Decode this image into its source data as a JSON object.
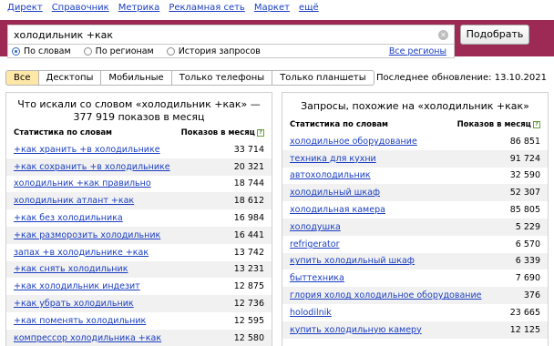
{
  "topnav": [
    "Директ",
    "Справочник",
    "Метрика",
    "Рекламная сеть",
    "Маркет",
    "ещё"
  ],
  "search": {
    "value": "холодильник +как",
    "button": "Подобрать"
  },
  "options": {
    "by_words": "По словам",
    "by_regions": "По регионам",
    "history": "История запросов",
    "all_regions": "Все регионы",
    "selected": "По словам"
  },
  "device_tabs": [
    "Все",
    "Десктопы",
    "Мобильные",
    "Только телефоны",
    "Только планшеты"
  ],
  "updated": "Последнее обновление: 13.10.2021",
  "left": {
    "title": "Что искали со словом «холодильник +как» — 377 919 показов в месяц",
    "col_stat": "Статистика по словам",
    "col_count": "Показов в месяц",
    "rows": [
      [
        "+как хранить +в холодильнике",
        "33 714"
      ],
      [
        "+как сохранить +в холодильнике",
        "20 321"
      ],
      [
        "холодильник +как правильно",
        "18 744"
      ],
      [
        "холодильник атлант +как",
        "18 612"
      ],
      [
        "+как без холодильника",
        "16 984"
      ],
      [
        "+как разморозить холодильник",
        "16 441"
      ],
      [
        "запах +в холодильнике +как",
        "13 742"
      ],
      [
        "+как снять холодильник",
        "13 231"
      ],
      [
        "+как холодильник индезит",
        "12 875"
      ],
      [
        "+как убрать холодильник",
        "12 736"
      ],
      [
        "+как поменять холодильник",
        "12 595"
      ],
      [
        "компрессор холодильника +как",
        "12 580"
      ]
    ]
  },
  "right": {
    "title": "Запросы, похожие на «холодильник +как»",
    "col_stat": "Статистика по словам",
    "col_count": "Показов в месяц",
    "rows": [
      [
        "холодильное оборудование",
        "86 851"
      ],
      [
        "техника для кухни",
        "91 724"
      ],
      [
        "автохолодильник",
        "32 590"
      ],
      [
        "холодильный шкаф",
        "52 307"
      ],
      [
        "холодильная камера",
        "85 805"
      ],
      [
        "холодушка",
        "5 229"
      ],
      [
        "refrigerator",
        "6 570"
      ],
      [
        "купить холодильный шкаф",
        "6 339"
      ],
      [
        "быттехника",
        "7 690"
      ],
      [
        "глория холод холодильное оборудование",
        "376"
      ],
      [
        "holodilnik",
        "23 665"
      ],
      [
        "купить холодильную камеру",
        "12 125"
      ]
    ]
  },
  "colors": {
    "band": "#9c2a55",
    "link": "#1a3dc1",
    "active_tab": "#ffe7a8"
  },
  "icons": {
    "clear": "clear-icon",
    "help": "help-icon"
  }
}
